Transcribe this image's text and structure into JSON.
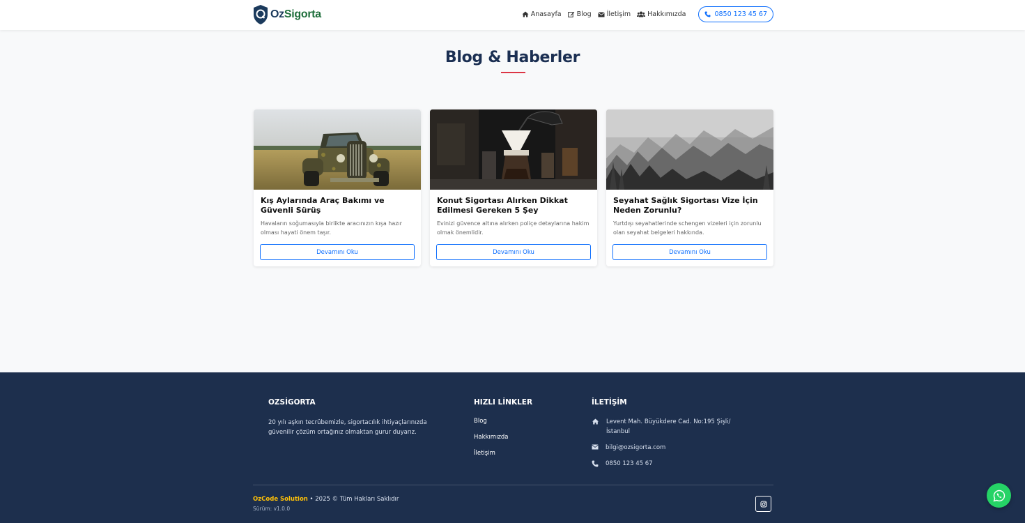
{
  "brand": {
    "name_part1": "Oz",
    "name_part2": "Sigorta"
  },
  "nav": {
    "items": [
      {
        "label": "Anasayfa",
        "icon": "home-icon"
      },
      {
        "label": "Blog",
        "icon": "edit-icon"
      },
      {
        "label": "İletişim",
        "icon": "envelope-icon"
      },
      {
        "label": "Hakkımızda",
        "icon": "users-icon"
      }
    ],
    "phone": "0850 123 45 67"
  },
  "page": {
    "title": "Blog & Haberler"
  },
  "posts": [
    {
      "title": "Kış Aylarında Araç Bakımı ve Güvenli Sürüş",
      "excerpt": "Havaların soğumasıyla birlikte aracınızın kışa hazır olması hayati önem taşır.",
      "button": "Devamını Oku",
      "image": "vintage-truck-photo"
    },
    {
      "title": "Konut Sigortası Alırken Dikkat Edilmesi Gereken 5 Şey",
      "excerpt": "Evinizi güvence altına alırken poliçe detaylarına hakim olmak önemlidir.",
      "button": "Devamını Oku",
      "image": "coffee-pourover-photo"
    },
    {
      "title": "Seyahat Sağlık Sigortası Vize İçin Neden Zorunlu?",
      "excerpt": "Yurtdışı seyahatlerinde schengen vizeleri için zorunlu olan seyahat belgeleri hakkında.",
      "button": "Devamını Oku",
      "image": "foggy-forest-photo"
    }
  ],
  "footer": {
    "about_heading": "OZSİGORTA",
    "about_text": "20 yılı aşkın tecrübemizle, sigortacılık ihtiyaçlarınızda güvenilir çözüm ortağınız olmaktan gurur duyarız.",
    "links_heading": "HIZLI LİNKLER",
    "links": [
      "Blog",
      "Hakkımızda",
      "İletişim"
    ],
    "contact_heading": "İLETİŞİM",
    "address": "Levent Mah. Büyükdere Cad. No:195 Şişli/ İstanbul",
    "email": "bilgi@ozsigorta.com",
    "phone": "0850 123 45 67",
    "copyright_brand": "OzCode Solution",
    "copyright_rest": " • 2025 © Tüm Hakları Saklıdır",
    "version": "Sürüm: v1.0.0"
  },
  "colors": {
    "primary": "#0d6efd",
    "navy": "#1d2f4d",
    "accent_red": "#dc3545",
    "whatsapp": "#25d366",
    "brand_yellow": "#ffc107"
  }
}
